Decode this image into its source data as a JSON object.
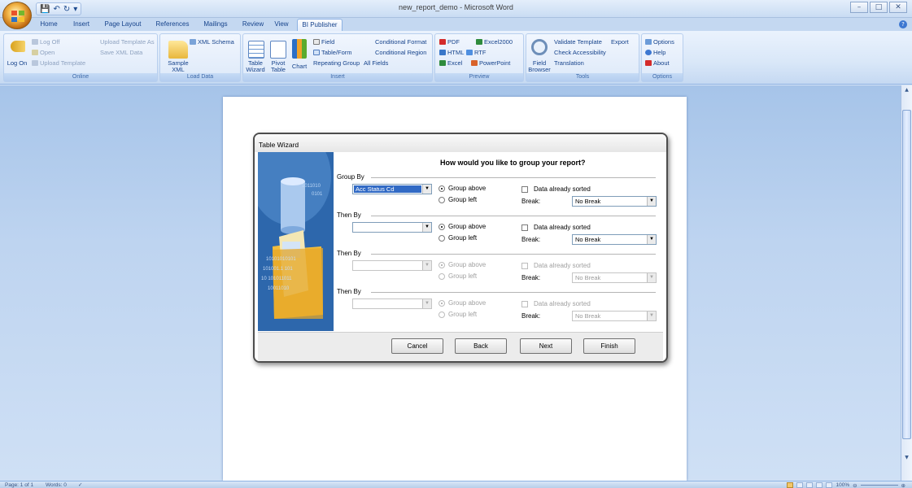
{
  "window": {
    "title": "new_report_demo - Microsoft Word",
    "controls": [
      "–",
      "□",
      "✕"
    ]
  },
  "qat": {
    "save": "💾",
    "undo": "↶",
    "redo": "↻",
    "customize": "▾"
  },
  "tabs": [
    "Home",
    "Insert",
    "Page Layout",
    "References",
    "Mailings",
    "Review",
    "View",
    "BI Publisher"
  ],
  "active_tab": "BI Publisher",
  "ribbon": {
    "online": {
      "label": "Online",
      "log_on": "Log On",
      "log_off": "Log Off",
      "open": "Open",
      "upload_template": "Upload Template",
      "upload_template_as": "Upload Template As",
      "save_xml_data": "Save XML Data"
    },
    "load_data": {
      "label": "Load Data",
      "sample_xml": "Sample XML",
      "xml_schema": "XML Schema"
    },
    "insert": {
      "label": "Insert",
      "table_wizard": "Table Wizard",
      "pivot_table": "Pivot Table",
      "chart": "Chart",
      "field": "Field",
      "table_form": "Table/Form",
      "repeating_group": "Repeating Group",
      "conditional_format": "Conditional Format",
      "conditional_region": "Conditional Region",
      "all_fields": "All Fields"
    },
    "preview": {
      "label": "Preview",
      "pdf": "PDF",
      "excel2000": "Excel2000",
      "html": "HTML",
      "rtf": "RTF",
      "excel": "Excel",
      "powerpoint": "PowerPoint"
    },
    "tools": {
      "label": "Tools",
      "field_browser": "Field Browser",
      "validate_template": "Validate Template",
      "export": "Export",
      "check_accessibility": "Check Accessibility",
      "translation": "Translation"
    },
    "options": {
      "label": "Options",
      "options": "Options",
      "help": "Help",
      "about": "About"
    }
  },
  "dialog": {
    "title": "Table Wizard",
    "heading": "How would you like to group your report?",
    "image_binary": [
      "1011010",
      "0101",
      "10101010101",
      "101001.1 101",
      "10 101011011",
      "10011010"
    ],
    "groups": [
      {
        "label": "Group By",
        "value": "Acc Status Cd",
        "group_above": "Group above",
        "group_left": "Group left",
        "data_sorted": "Data already sorted",
        "break_label": "Break:",
        "break_value": "No Break",
        "enabled": true
      },
      {
        "label": "Then By",
        "value": "",
        "group_above": "Group above",
        "group_left": "Group left",
        "data_sorted": "Data already sorted",
        "break_label": "Break:",
        "break_value": "No Break",
        "enabled": true
      },
      {
        "label": "Then By",
        "value": "",
        "group_above": "Group above",
        "group_left": "Group left",
        "data_sorted": "Data already sorted",
        "break_label": "Break:",
        "break_value": "No Break",
        "enabled": false
      },
      {
        "label": "Then By",
        "value": "",
        "group_above": "Group above",
        "group_left": "Group left",
        "data_sorted": "Data already sorted",
        "break_label": "Break:",
        "break_value": "No Break",
        "enabled": false
      }
    ],
    "buttons": {
      "cancel": "Cancel",
      "back": "Back",
      "next": "Next",
      "finish": "Finish"
    }
  },
  "status": {
    "page": "Page: 1 of 1",
    "words": "Words: 0",
    "zoom": "100%"
  }
}
